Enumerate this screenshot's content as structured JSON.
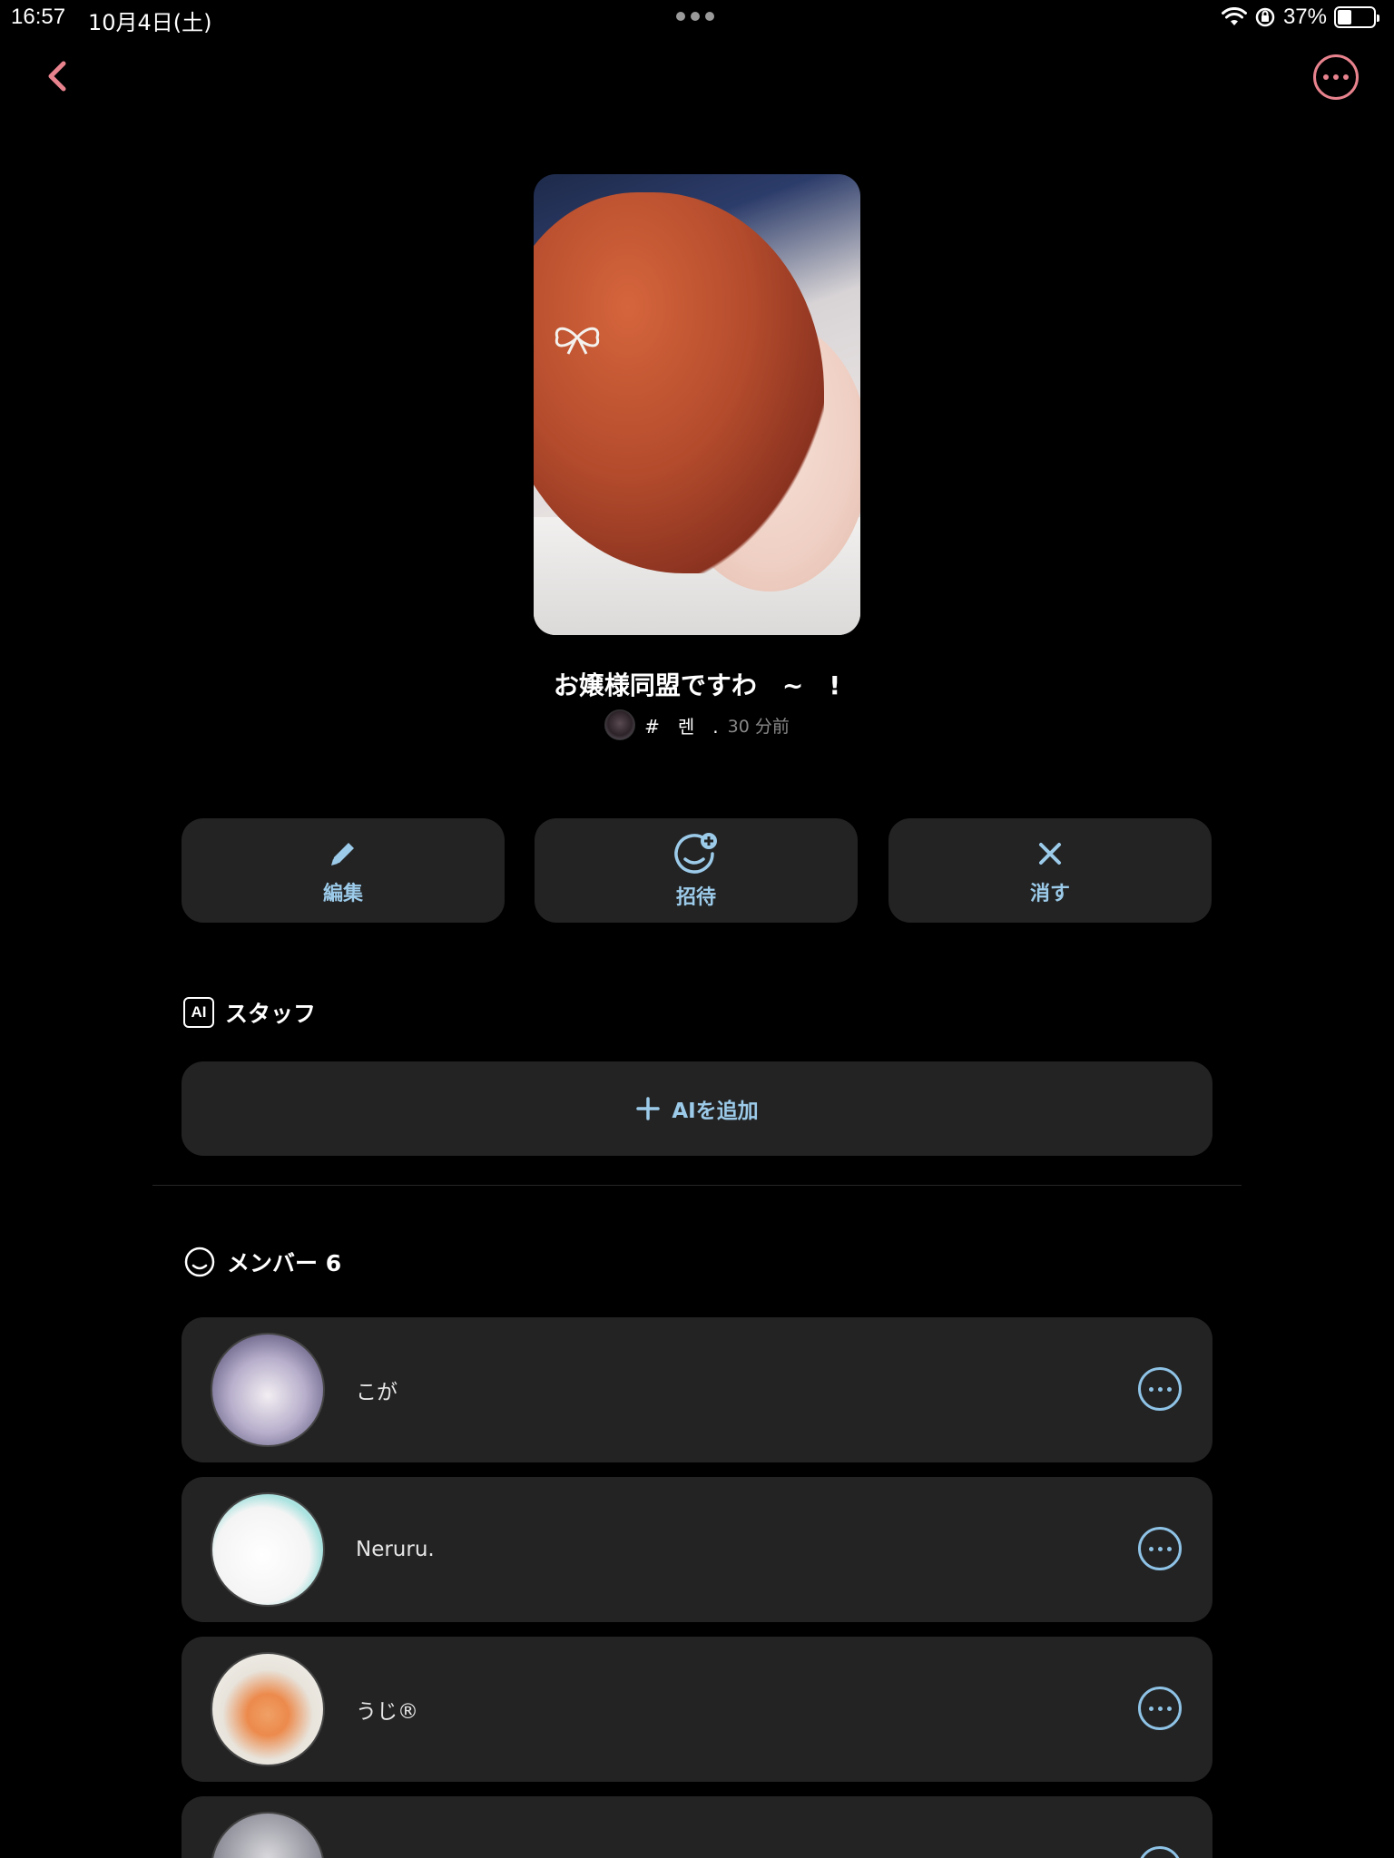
{
  "status_bar": {
    "time": "16:57",
    "date": "10月4日(土)",
    "battery": "37%",
    "battery_level": 0.37,
    "icons": [
      "wifi-icon",
      "orientation-lock-icon",
      "battery-icon"
    ]
  },
  "nav": {
    "back_icon": "chevron-left-icon",
    "more_icon": "ellipsis-circle-icon",
    "accent_color": "#e8838e"
  },
  "group": {
    "title": "お嬢様同盟ですわ　~　!",
    "owner_name": "#　렌　.",
    "time_ago": "30 分前"
  },
  "actions": [
    {
      "label": "編集",
      "icon": "pencil-icon"
    },
    {
      "label": "招待",
      "icon": "invite-user-icon"
    },
    {
      "label": "消す",
      "icon": "close-icon"
    }
  ],
  "staff": {
    "badge": "AI",
    "heading": "スタッフ",
    "add_label": "AIを追加"
  },
  "members": {
    "heading": "メンバー 6",
    "items": [
      {
        "name": "こが"
      },
      {
        "name": "Neruru."
      },
      {
        "name": "うじ®"
      },
      {
        "name": ""
      }
    ]
  },
  "colors": {
    "background": "#000000",
    "card": "#232323",
    "action_blue": "#9ccbea"
  }
}
